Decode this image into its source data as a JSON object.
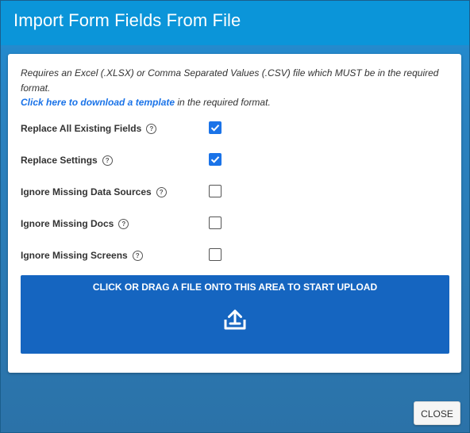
{
  "dialog": {
    "title": "Import Form Fields From File"
  },
  "description": {
    "line1": "Requires an Excel (.XLSX) or Comma Separated Values (.CSV) file which MUST be in the required format.",
    "link_text": "Click here to download a template",
    "line2_suffix": " in the required format."
  },
  "options": [
    {
      "label": "Replace All Existing Fields",
      "help_icon": "?",
      "checked": true
    },
    {
      "label": "Replace Settings",
      "help_icon": "?",
      "checked": true
    },
    {
      "label": "Ignore Missing Data Sources",
      "help_icon": "?",
      "checked": false
    },
    {
      "label": "Ignore Missing Docs",
      "help_icon": "?",
      "checked": false
    },
    {
      "label": "Ignore Missing Screens",
      "help_icon": "?",
      "checked": false
    }
  ],
  "dropzone": {
    "text": "CLICK OR DRAG A FILE ONTO THIS AREA TO START UPLOAD",
    "icon": "upload-icon"
  },
  "footer": {
    "close_label": "CLOSE"
  },
  "colors": {
    "header": "#0b95d9",
    "accent": "#1a73e8",
    "dropzone": "#1565c0",
    "backdrop": "#2b72a8"
  }
}
